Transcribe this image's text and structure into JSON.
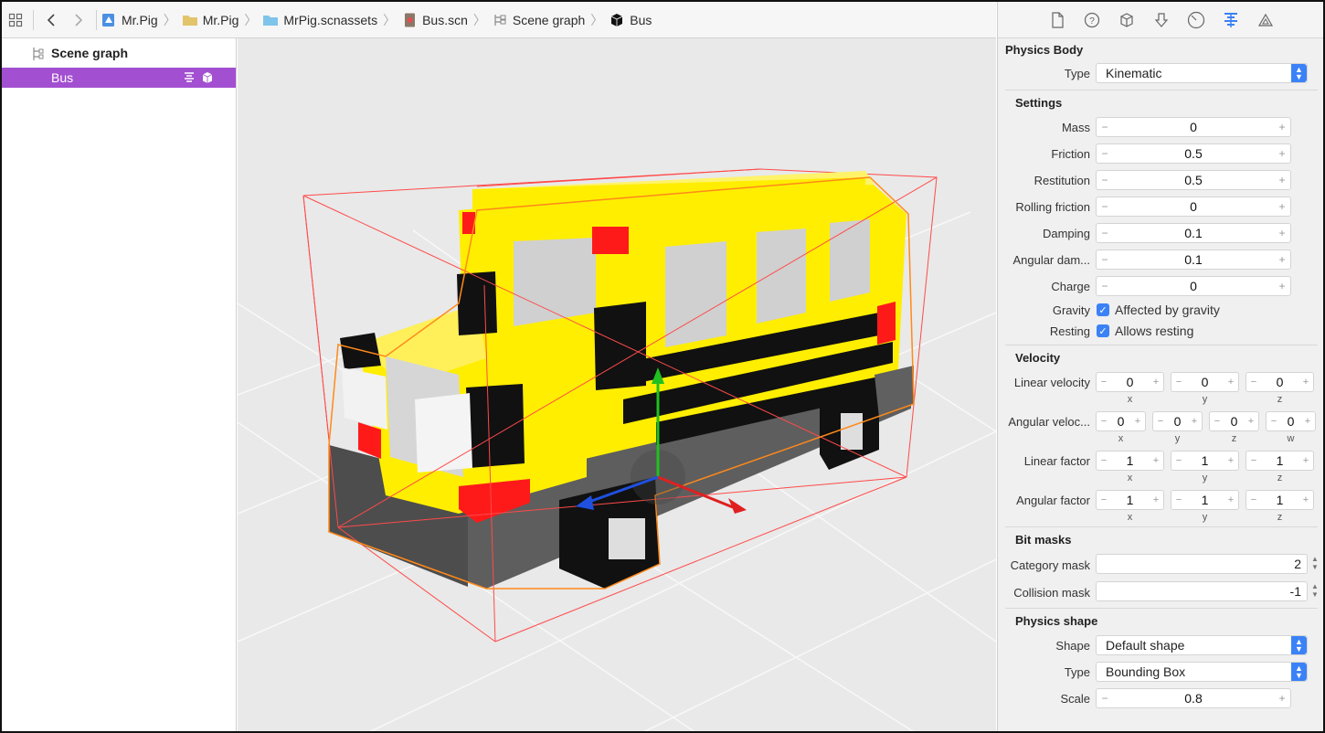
{
  "breadcrumb": {
    "items": [
      {
        "label": "Mr.Pig",
        "icon": "project-icon",
        "color": "#4a90e2"
      },
      {
        "label": "Mr.Pig",
        "icon": "folder-icon",
        "color": "#e2c46a"
      },
      {
        "label": "MrPig.scnassets",
        "icon": "folder-icon",
        "color": "#7fc4ea"
      },
      {
        "label": "Bus.scn",
        "icon": "scene-file-icon",
        "color": "#6b5a4a"
      },
      {
        "label": "Scene graph",
        "icon": "tree-icon",
        "color": "#888888"
      },
      {
        "label": "Bus",
        "icon": "node-cube-icon",
        "color": "#111111"
      }
    ]
  },
  "scene_graph": {
    "title": "Scene graph",
    "selected_node": "Bus",
    "selection_color": "#a34fd1"
  },
  "inspector": {
    "tabs": [
      "file-icon",
      "help-icon",
      "cube-icon",
      "attributes-icon",
      "gauge-icon",
      "physics-icon",
      "material-icon"
    ],
    "physics_body": {
      "title": "Physics Body",
      "type_label": "Type",
      "type_value": "Kinematic"
    },
    "settings": {
      "title": "Settings",
      "rows": [
        {
          "label": "Mass",
          "value": "0"
        },
        {
          "label": "Friction",
          "value": "0.5"
        },
        {
          "label": "Restitution",
          "value": "0.5"
        },
        {
          "label": "Rolling friction",
          "value": "0"
        },
        {
          "label": "Damping",
          "value": "0.1"
        },
        {
          "label": "Angular dam...",
          "value": "0.1"
        },
        {
          "label": "Charge",
          "value": "0"
        }
      ],
      "gravity": {
        "label": "Gravity",
        "text": "Affected by gravity",
        "checked": true
      },
      "resting": {
        "label": "Resting",
        "text": "Allows resting",
        "checked": true
      }
    },
    "velocity": {
      "title": "Velocity",
      "linear_velocity": {
        "label": "Linear velocity",
        "x": "0",
        "y": "0",
        "z": "0"
      },
      "angular_velocity": {
        "label": "Angular veloc...",
        "x": "0",
        "y": "0",
        "z": "0",
        "w": "0"
      },
      "linear_factor": {
        "label": "Linear factor",
        "x": "1",
        "y": "1",
        "z": "1"
      },
      "angular_factor": {
        "label": "Angular factor",
        "x": "1",
        "y": "1",
        "z": "1"
      },
      "axis_x": "x",
      "axis_y": "y",
      "axis_z": "z",
      "axis_w": "w"
    },
    "bit_masks": {
      "title": "Bit masks",
      "category_label": "Category mask",
      "category_value": "2",
      "collision_label": "Collision mask",
      "collision_value": "-1"
    },
    "physics_shape": {
      "title": "Physics shape",
      "shape_label": "Shape",
      "shape_value": "Default shape",
      "type_label": "Type",
      "type_value": "Bounding Box",
      "scale_label": "Scale",
      "scale_value": "0.8"
    },
    "stepper_minus": "−",
    "stepper_plus": "+"
  },
  "colors": {
    "accent": "#3b82f6",
    "bus_yellow": "#ffee00",
    "bounding_box": "#ff4a4a"
  }
}
